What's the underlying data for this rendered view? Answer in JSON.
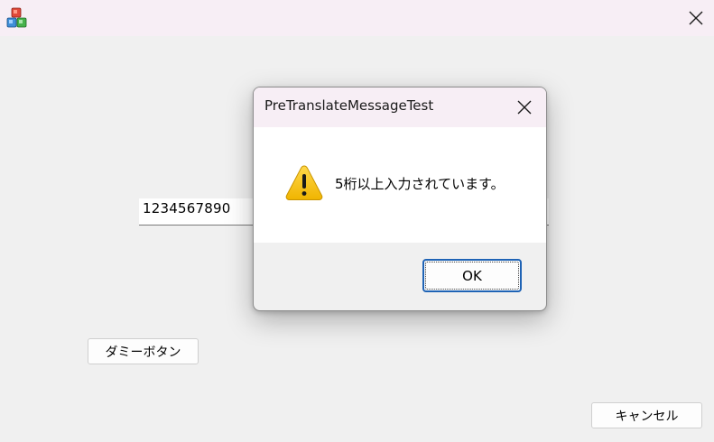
{
  "window": {
    "app_icon": "app-blocks-icon",
    "close_icon": "close-icon"
  },
  "main": {
    "input_value": "1234567890",
    "dummy_button_label": "ダミーボタン",
    "cancel_button_label": "キャンセル"
  },
  "dialog": {
    "title": "PreTranslateMessageTest",
    "message": "5桁以上入力されています。",
    "icon": "warning-icon",
    "ok_label": "OK"
  },
  "colors": {
    "titlebar_bg": "#f7eef5",
    "window_bg": "#f0f0f0",
    "warning_yellow": "#f5c400",
    "focus_border": "#1f63b5"
  }
}
